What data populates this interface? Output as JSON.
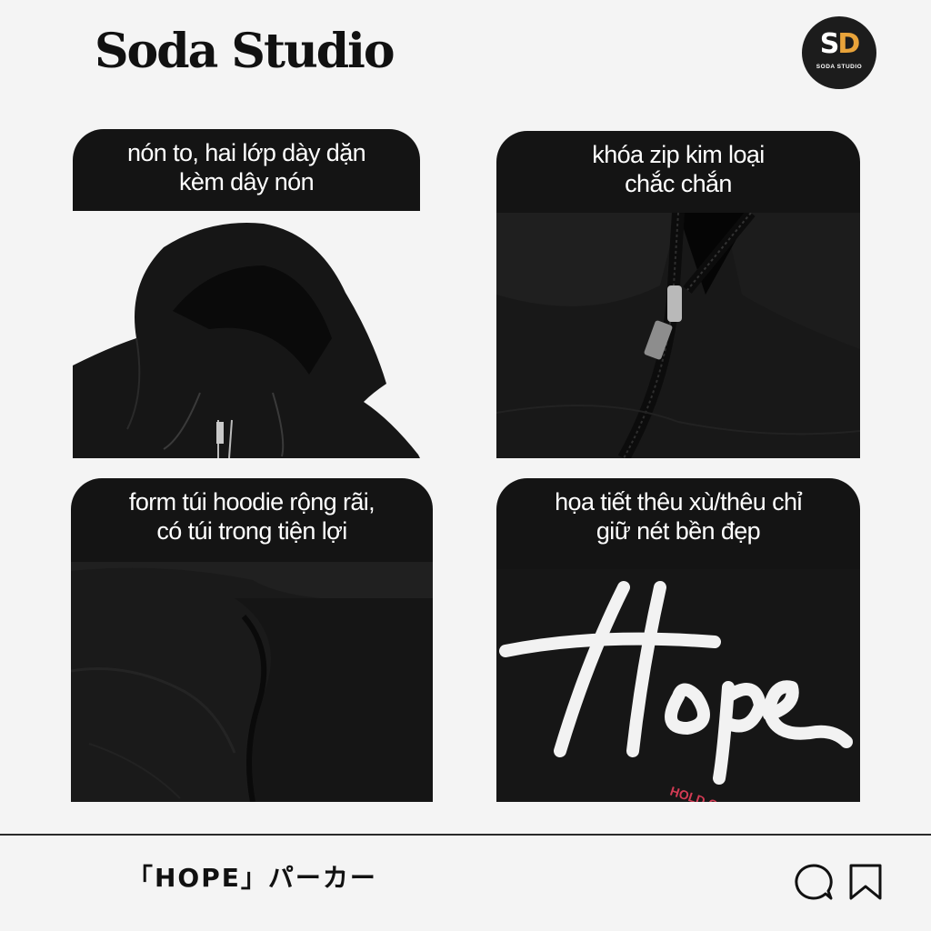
{
  "header": {
    "brand": "Soda Studio",
    "logo": {
      "mark_s": "S",
      "mark_d": "D",
      "caption": "SODA STUDIO",
      "accent": "#e8a33a"
    }
  },
  "features": [
    {
      "label": "nón to, hai lớp dày dặn\nkèm dây nón",
      "image": "hood-photo"
    },
    {
      "label": "khóa zip kim loại\nchắc chắn",
      "image": "zipper-photo"
    },
    {
      "label": "form túi hoodie rộng rãi,\ncó túi trong tiện lợi",
      "image": "pocket-photo"
    },
    {
      "label": "họa tiết thêu xù/thêu chỉ\ngiữ nét bền đẹp",
      "image": "embroidery-photo",
      "embroidery_text": "Hope",
      "embroidery_subtext": "HOLD ON"
    }
  ],
  "footer": {
    "product_name": "「HOPE」パーカー",
    "icons": [
      "comment-icon",
      "bookmark-icon"
    ]
  }
}
